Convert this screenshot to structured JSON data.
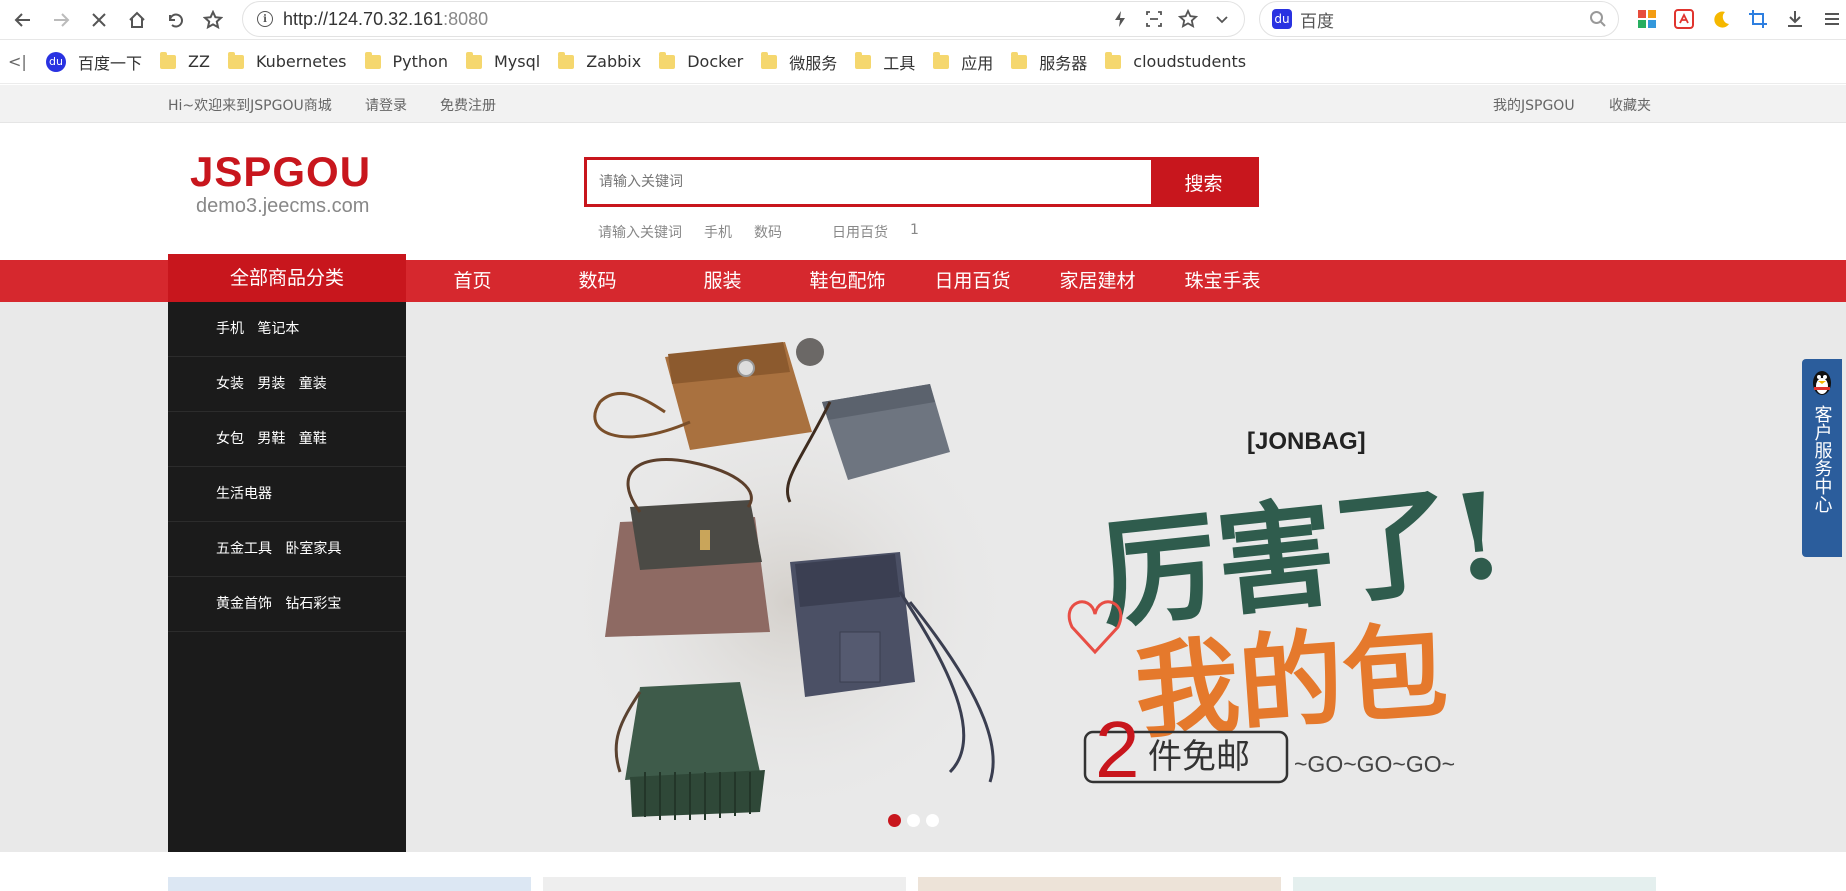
{
  "browser": {
    "url_host": "http://124.70.32.161",
    "url_port": ":8080",
    "search_engine_text": "百度"
  },
  "bookmarks": {
    "items": [
      "百度一下",
      "ZZ",
      "Kubernetes",
      "Python",
      "Mysql",
      "Zabbix",
      "Docker",
      "微服务",
      "工具",
      "应用",
      "服务器",
      "cloudstudents"
    ]
  },
  "topbar": {
    "welcome": "Hi~欢迎来到JSPGOU商城",
    "login": "请登录",
    "register": "免费注册",
    "my_account": "我的JSPGOU",
    "favorites": "收藏夹"
  },
  "header": {
    "logo_main": "JSPGOU",
    "logo_sub": "demo3.jeecms.com",
    "search_placeholder": "请输入关键词",
    "search_button": "搜索",
    "hot_words": [
      "请输入关键词",
      "手机",
      "数码",
      "日用百货",
      "1"
    ]
  },
  "nav": {
    "category_title": "全部商品分类",
    "items": [
      "首页",
      "数码",
      "服装",
      "鞋包配饰",
      "日用百货",
      "家居建材",
      "珠宝手表"
    ]
  },
  "categories": [
    "手机   笔记本",
    "女装   男装   童装",
    "女包   男鞋   童鞋",
    "生活电器",
    "五金工具   卧室家具",
    "黄金首饰   钻石彩宝"
  ],
  "banner": {
    "brand": "[JONBAG]",
    "headline_1": "厉害了!",
    "headline_2": "我的包",
    "promo": "2件免邮",
    "tagline": "~GO~GO~GO~",
    "slides": 3,
    "active_slide": 1
  },
  "service": {
    "label": "客户服务中心"
  },
  "colors": {
    "brand_red": "#c8161d",
    "nav_red": "#d6282e",
    "category_bg": "#1b1b1b",
    "service_blue": "#2b5d9c"
  }
}
